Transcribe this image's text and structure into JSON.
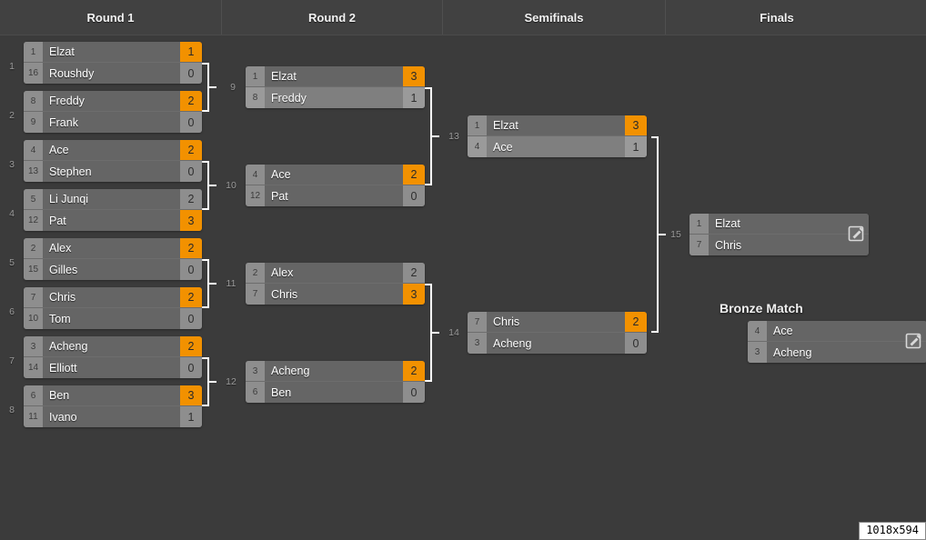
{
  "window": {
    "size_badge": "1018x594"
  },
  "header": {
    "rounds": [
      {
        "label": "Round 1"
      },
      {
        "label": "Round 2"
      },
      {
        "label": "Semifinals"
      },
      {
        "label": "Finals"
      }
    ]
  },
  "bronze": {
    "title": "Bronze Match"
  },
  "icons": {
    "edit": "edit-pencil-icon"
  },
  "matches": [
    {
      "id": "1",
      "number": "1",
      "top": {
        "seed": "1",
        "name": "Elzat",
        "score": "1",
        "winner": true,
        "highlight": false
      },
      "bottom": {
        "seed": "16",
        "name": "Roushdy",
        "score": "0",
        "winner": false,
        "highlight": false
      }
    },
    {
      "id": "2",
      "number": "2",
      "top": {
        "seed": "8",
        "name": "Freddy",
        "score": "2",
        "winner": true,
        "highlight": false
      },
      "bottom": {
        "seed": "9",
        "name": "Frank",
        "score": "0",
        "winner": false,
        "highlight": false
      }
    },
    {
      "id": "3",
      "number": "3",
      "top": {
        "seed": "4",
        "name": "Ace",
        "score": "2",
        "winner": true,
        "highlight": false
      },
      "bottom": {
        "seed": "13",
        "name": "Stephen",
        "score": "0",
        "winner": false,
        "highlight": false
      }
    },
    {
      "id": "4",
      "number": "4",
      "top": {
        "seed": "5",
        "name": "Li Junqi",
        "score": "2",
        "winner": false,
        "highlight": false
      },
      "bottom": {
        "seed": "12",
        "name": "Pat",
        "score": "3",
        "winner": true,
        "highlight": false
      }
    },
    {
      "id": "5",
      "number": "5",
      "top": {
        "seed": "2",
        "name": "Alex",
        "score": "2",
        "winner": true,
        "highlight": false
      },
      "bottom": {
        "seed": "15",
        "name": "Gilles",
        "score": "0",
        "winner": false,
        "highlight": false
      }
    },
    {
      "id": "6",
      "number": "6",
      "top": {
        "seed": "7",
        "name": "Chris",
        "score": "2",
        "winner": true,
        "highlight": false
      },
      "bottom": {
        "seed": "10",
        "name": "Tom",
        "score": "0",
        "winner": false,
        "highlight": false
      }
    },
    {
      "id": "7",
      "number": "7",
      "top": {
        "seed": "3",
        "name": "Acheng",
        "score": "2",
        "winner": true,
        "highlight": false
      },
      "bottom": {
        "seed": "14",
        "name": "Elliott",
        "score": "0",
        "winner": false,
        "highlight": false
      }
    },
    {
      "id": "8",
      "number": "8",
      "top": {
        "seed": "6",
        "name": "Ben",
        "score": "3",
        "winner": true,
        "highlight": false
      },
      "bottom": {
        "seed": "11",
        "name": "Ivano",
        "score": "1",
        "winner": false,
        "highlight": false
      }
    },
    {
      "id": "9",
      "number": "9",
      "top": {
        "seed": "1",
        "name": "Elzat",
        "score": "3",
        "winner": true,
        "highlight": false
      },
      "bottom": {
        "seed": "8",
        "name": "Freddy",
        "score": "1",
        "winner": false,
        "highlight": true
      }
    },
    {
      "id": "10",
      "number": "10",
      "top": {
        "seed": "4",
        "name": "Ace",
        "score": "2",
        "winner": true,
        "highlight": false
      },
      "bottom": {
        "seed": "12",
        "name": "Pat",
        "score": "0",
        "winner": false,
        "highlight": false
      }
    },
    {
      "id": "11",
      "number": "11",
      "top": {
        "seed": "2",
        "name": "Alex",
        "score": "2",
        "winner": false,
        "highlight": false
      },
      "bottom": {
        "seed": "7",
        "name": "Chris",
        "score": "3",
        "winner": true,
        "highlight": false
      }
    },
    {
      "id": "12",
      "number": "12",
      "top": {
        "seed": "3",
        "name": "Acheng",
        "score": "2",
        "winner": true,
        "highlight": false
      },
      "bottom": {
        "seed": "6",
        "name": "Ben",
        "score": "0",
        "winner": false,
        "highlight": false
      }
    },
    {
      "id": "13",
      "number": "13",
      "top": {
        "seed": "1",
        "name": "Elzat",
        "score": "3",
        "winner": true,
        "highlight": false
      },
      "bottom": {
        "seed": "4",
        "name": "Ace",
        "score": "1",
        "winner": false,
        "highlight": true
      }
    },
    {
      "id": "14",
      "number": "14",
      "top": {
        "seed": "7",
        "name": "Chris",
        "score": "2",
        "winner": true,
        "highlight": false
      },
      "bottom": {
        "seed": "3",
        "name": "Acheng",
        "score": "0",
        "winner": false,
        "highlight": false
      }
    },
    {
      "id": "15",
      "number": "15",
      "top": {
        "seed": "1",
        "name": "Elzat",
        "score": "",
        "winner": false,
        "highlight": false
      },
      "bottom": {
        "seed": "7",
        "name": "Chris",
        "score": "",
        "winner": false,
        "highlight": false
      }
    },
    {
      "id": "bronze",
      "number": "",
      "top": {
        "seed": "4",
        "name": "Ace",
        "score": "",
        "winner": false,
        "highlight": false
      },
      "bottom": {
        "seed": "3",
        "name": "Acheng",
        "score": "",
        "winner": false,
        "highlight": false
      }
    }
  ]
}
